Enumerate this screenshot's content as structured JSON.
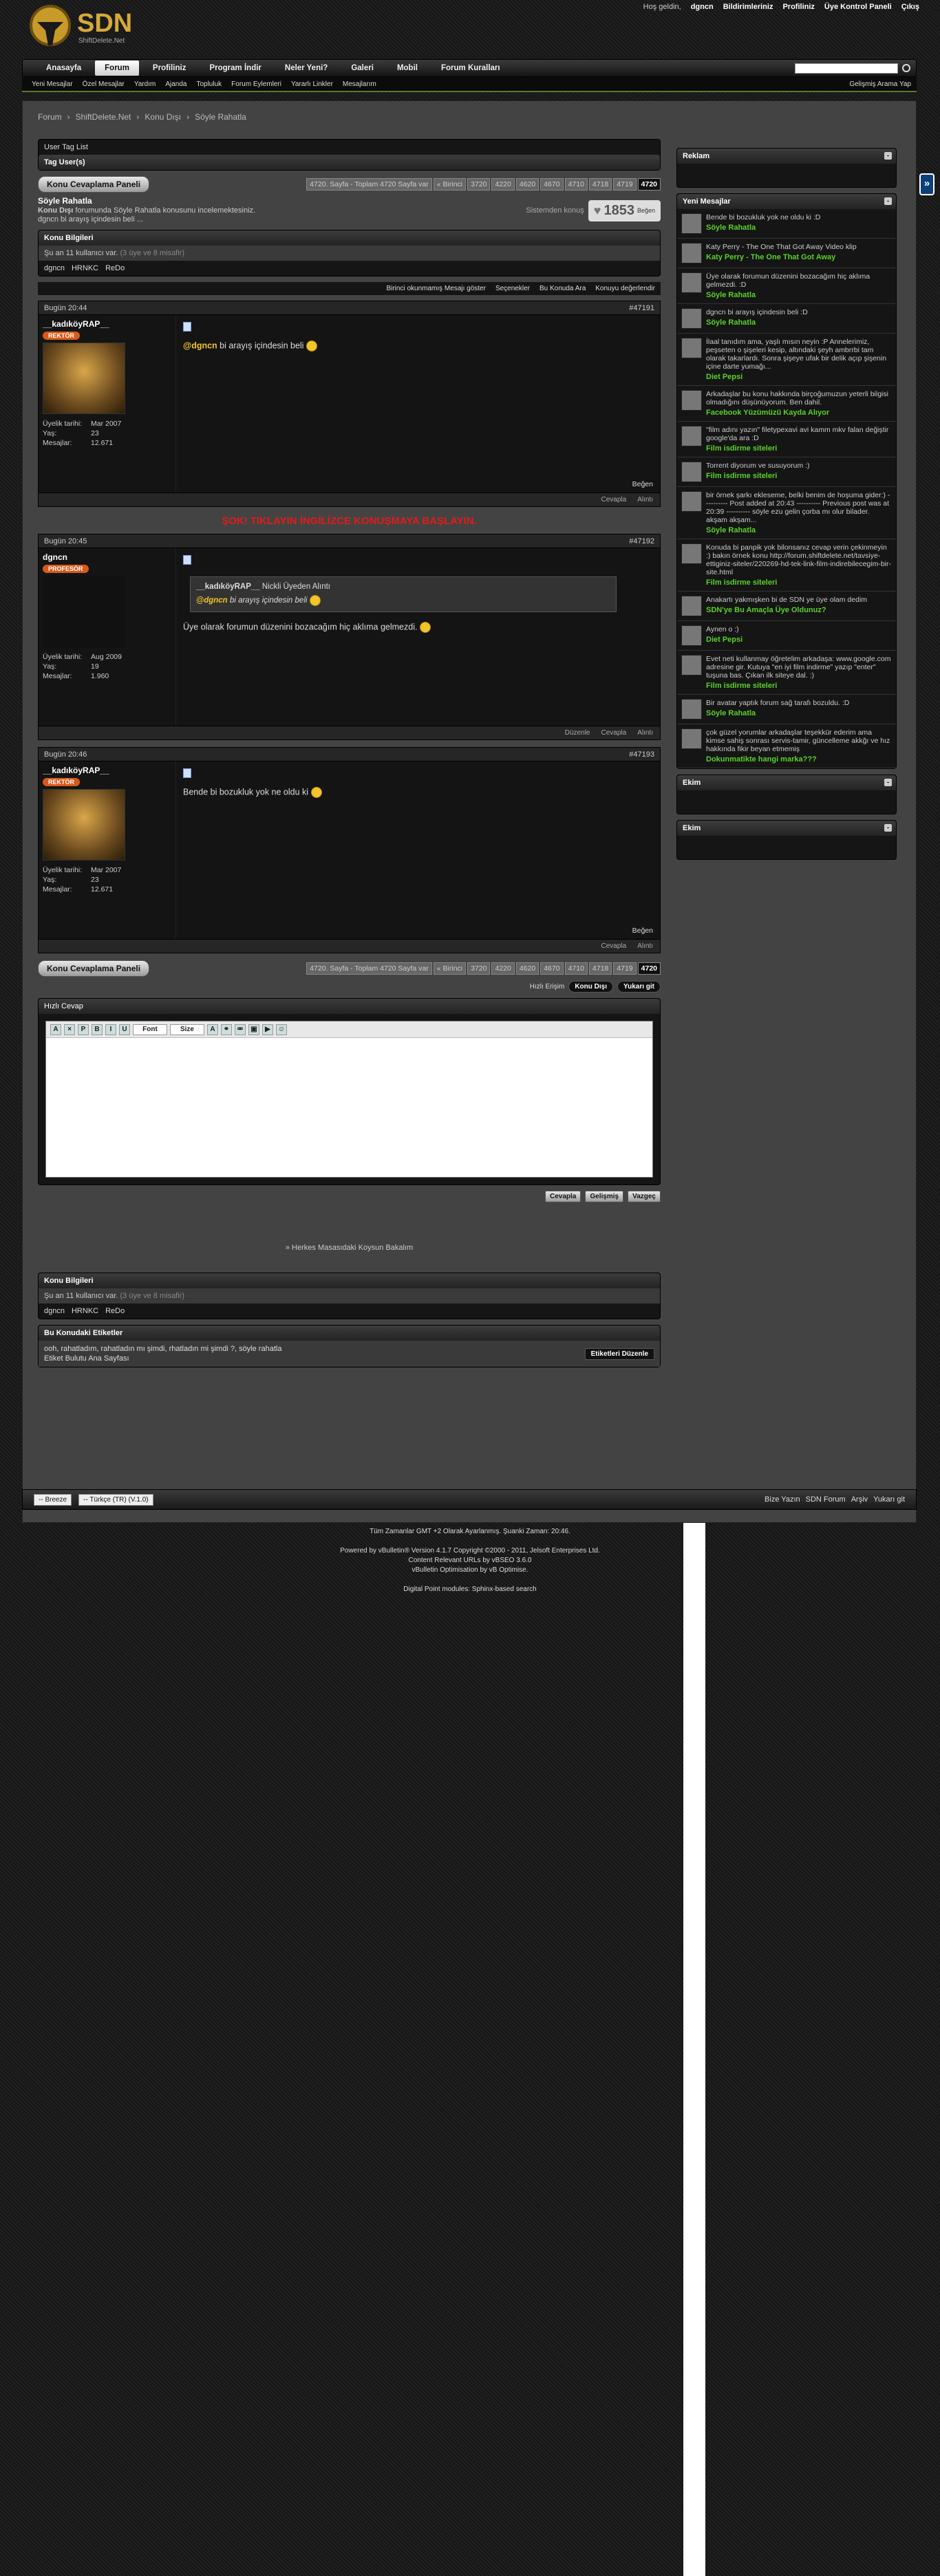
{
  "header": {
    "logo_text": "SDN",
    "logo_sub": "ShiftDelete.Net",
    "welcome": "Hoş geldin,",
    "username": "dgncn",
    "links": [
      "Bildirimleriniz",
      "Profiliniz",
      "Üye Kontrol Paneli",
      "Çıkış"
    ]
  },
  "nav": {
    "tabs": [
      "Anasayfa",
      "Forum",
      "Profiliniz",
      "Program İndir",
      "Neler Yeni?",
      "Galeri",
      "Mobil",
      "Forum Kuralları"
    ],
    "selected": 1,
    "subnav": [
      "Yeni Mesajlar",
      "Özel Mesajlar",
      "Yardım",
      "Ajanda",
      "Topluluk",
      "Forum Eylemleri",
      "Yararlı Linkler",
      "Mesajlarım"
    ],
    "advanced": "Gelişmiş Arama Yap"
  },
  "breadcrumb": [
    "Forum",
    "ShiftDelete.Net",
    "Konu Dışı",
    "Söyle Rahatla"
  ],
  "taglist": {
    "title": "User Tag List",
    "subtitle": "Tag User(s)"
  },
  "reply_button": "Konu Cevaplama Paneli",
  "pagenav": {
    "summary": "4720. Sayfa - Toplam 4720 Sayfa var",
    "first": "« Birinci",
    "pages": [
      "3720",
      "4220",
      "4620",
      "4670",
      "4710",
      "4718",
      "4719",
      "4720"
    ],
    "current": "4720"
  },
  "thread": {
    "title": "Söyle Rahatla",
    "desc_forum": "Konu Dışı",
    "desc": "forumunda Söyle Rahatla konusunu incelemektesiniz.",
    "viewer": "dgncn bi arayış içindesin beli ...",
    "likes_count": "1853",
    "likes_label": "Beğen",
    "tagged": "Sistemden konuş"
  },
  "info": {
    "title": "Konu Bilgileri",
    "users": "Şu an 11 kullanıcı var.",
    "users_sub": "(3 üye ve 8 misafir)",
    "members": [
      "dgncn",
      "HRNKC",
      "ReDo"
    ]
  },
  "tools": [
    "Birinci okunmamış Mesajı göster",
    "Seçenekler",
    "Bu Konuda Ara",
    "Konuyu değerlendir"
  ],
  "posts": [
    {
      "date": "Bugün 20:44",
      "num": "#47191",
      "user": "__kadıköyRAP__",
      "rank": "REKTÖR",
      "join_label": "Üyelik tarihi:",
      "join": "Mar 2007",
      "age_label": "Yaş:",
      "age": "23",
      "msgs_label": "Mesajlar:",
      "msgs": "12.671",
      "mention": "@dgncn",
      "text": "bi arayış içindesin beli",
      "like": "Beğen",
      "foot": [
        "Cevapla",
        "Alıntı"
      ]
    },
    {
      "date": "Bugün 20:45",
      "num": "#47192",
      "user": "dgncn",
      "rank": "PROFESÖR",
      "join_label": "Üyelik tarihi:",
      "join": "Aug 2009",
      "age_label": "Yaş:",
      "age": "19",
      "msgs_label": "Mesajlar:",
      "msgs": "1.960",
      "quote_by": "__kadıköyRAP__",
      "quote_by_suffix": "Nickli Üyeden Alıntı",
      "quote_mention": "@dgncn",
      "quote_text": "bi arayış içindesin beli",
      "text": "Üye olarak forumun düzenini bozacağım hiç aklıma gelmezdi.",
      "foot": [
        "Düzenle",
        "Cevapla",
        "Alıntı"
      ]
    },
    {
      "date": "Bugün 20:46",
      "num": "#47193",
      "user": "__kadıköyRAP__",
      "rank": "REKTÖR",
      "join_label": "Üyelik tarihi:",
      "join": "Mar 2007",
      "age_label": "Yaş:",
      "age": "23",
      "msgs_label": "Mesajlar:",
      "msgs": "12.671",
      "text": "Bende bi bozukluk yok ne oldu ki",
      "like": "Beğen",
      "foot": [
        "Cevapla",
        "Alıntı"
      ]
    }
  ],
  "redline": "ŞOK! TIKLAYIN İNGİLİZCE KONUŞMAYA BAŞLAYIN.",
  "quickreply": {
    "title": "Hızlı Cevap",
    "goto": "Hızlı Erişim",
    "goto_btn": "Konu Dışı",
    "go": "Yukarı git",
    "font": "Font",
    "size": "Size",
    "buttons": [
      "Cevapla",
      "Gelişmiş",
      "Vazgeç"
    ]
  },
  "promo": "» Herkes Masasıdaki Koysun Bakalım",
  "tags": {
    "title": "Bu Konudaki Etiketler",
    "list": "ooh, rahatladım, rahatladın mı şimdi, rhatladın mi şimdi ?, söyle rahatla",
    "cloud": "Etiket Bulutu Ana Sayfası",
    "edit": "Etiketleri Düzenle"
  },
  "sidebar": {
    "ad_title": "Reklam",
    "new_title": "Yeni Mesajlar",
    "items": [
      {
        "text": "Bende bi bozukluk yok ne oldu ki :D",
        "title": "Söyle Rahatla"
      },
      {
        "text": "Katy Perry - The One That Got Away Video klip",
        "title": "Katy Perry - The One That Got Away"
      },
      {
        "text": "Üye olarak forumun düzenini bozacağım hiç aklıma gelmezdi. :D",
        "title": "Söyle Rahatla"
      },
      {
        "text": "dgncn bi arayış içindesin beli :D",
        "title": "Söyle Rahatla"
      },
      {
        "text": "İlaal tanıdım ama, yaşlı mısın neyin :P Annelerimiz, peşseten o şişeleri kesip, altındaki şeyh ambrrbi tam olarak takarlardı. Sonra şişeye ufak bir delik açıp şişenin içine darte yumağı...",
        "title": "Diet Pepsi"
      },
      {
        "text": "Arkadaşlar bu konu hakkında birçoğumuzun yeterli bilgisi olmadığını düşünüyorum. Ben dahil.",
        "title": "Facebook Yüzümüzü Kayda Alıyor"
      },
      {
        "text": "\"film adını yazın\" filetypexavi avi kamm mkv falan değiştir google'da ara :D",
        "title": "Film isdirme siteleri"
      },
      {
        "text": "Torrent diyorum ve susuyorum :)",
        "title": "Film isdirme siteleri"
      },
      {
        "text": "bir örnek şarkı ekleseme, belki benim de hoşuma gider:) ---------- Post added at 20:43 ---------- Previous post was at 20:39 ---------- söyle ezu gelin çorba mı olur bilader. akşam akşam...",
        "title": "Söyle Rahatla"
      },
      {
        "text": "Konuda bi panpik yok bilonsanız cevap verin çekinmeyin :) bakın örnek konu http://forum.shiftdelete.net/tavsiye-ettiginiz-siteler/220269-hd-tek-link-film-indirebilecegim-bir-site.html",
        "title": "Film isdirme siteleri"
      },
      {
        "text": "Anakartı yakmışken bi de SDN ye üye olam dedim",
        "title": "SDN'ye Bu Amaçla Üye Oldunuz?"
      },
      {
        "text": "Aynen o :)",
        "title": "Diet Pepsi"
      },
      {
        "text": "Evet neti kullanmay öğretelim arkadaşa: www.google.com adresine gir. Kutuya \"en iyi film indirme\" yazıp \"enter\" tuşuna bas. Çıkan ilk siteye dal. :)",
        "title": "Film isdirme siteleri"
      },
      {
        "text": "Bir avatar yaptık forum sağ tarafı bozuldu. :D",
        "title": "Söyle Rahatla"
      },
      {
        "text": "çok güzel yorumlar arkadaşlar teşekkür ederim ama kimse sahiş sonrası servis-tamir, güncelleme akkğı ve hız hakkında fikir beyan etmemiş",
        "title": "Dokunmatikte hangi marka???"
      }
    ],
    "box3": "Ekim",
    "box4": "Ekim"
  },
  "footer": {
    "style": "-- Breeze",
    "lang": "-- Türkçe (TR) (V.1.0)",
    "links": [
      "Bize Yazın",
      "SDN Forum",
      "Arşiv",
      "Yukarı git"
    ]
  },
  "copyright": {
    "time": "Tüm Zamanlar GMT +2 Olarak Ayarlanmış. Şuanki Zaman: 20:46.",
    "powered": "Powered by vBulletin® Version 4.1.7 Copyright ©2000 - 2011, Jelsoft Enterprises Ltd.",
    "content": "Content Relevant URLs by vBSEO 3.6.0",
    "opt": "vBulletin Optimisation by vB Optimise.",
    "digital": "Digital Point modules: Sphinx-based search"
  },
  "colors": {
    "accent": "#5bd12a",
    "red": "#e21b1b",
    "gold": "#f2c52a",
    "rank": "#d75a1a"
  }
}
